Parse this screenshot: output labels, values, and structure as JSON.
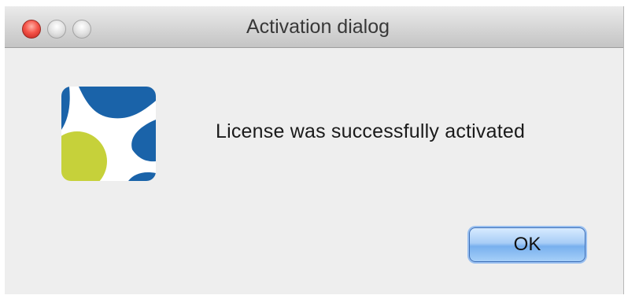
{
  "window": {
    "title": "Activation dialog"
  },
  "titlebar_buttons": [
    "close-button",
    "minimize-button",
    "zoom-button"
  ],
  "dialog": {
    "message": "License was successfully activated",
    "ok_label": "OK"
  },
  "colors": {
    "logo_blue": "#1a63a9",
    "logo_green": "#c6d13a",
    "button_blue": "#8fc0f4"
  }
}
